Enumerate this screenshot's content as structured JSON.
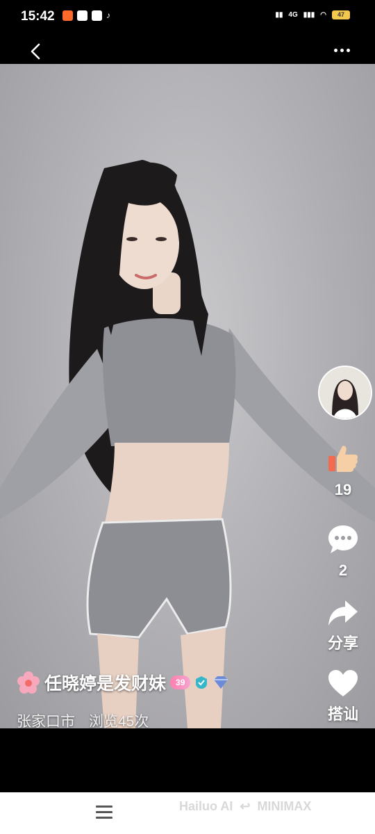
{
  "status": {
    "time": "15:42",
    "battery": "47",
    "signal_label": "4G"
  },
  "post": {
    "author_name": "任晓婷是发财妹",
    "level_badge": "39",
    "location": "张家口市",
    "views": "浏览45次"
  },
  "actions": {
    "likes": "19",
    "comments": "2",
    "share_label": "分享",
    "greet_label": "搭讪"
  },
  "watermark": {
    "left": "Hailuo AI",
    "right": "MINIMAX"
  },
  "colors": {
    "like": "#f26b4f",
    "badge": "#ff7fb0",
    "verified": "#36b6c9"
  }
}
